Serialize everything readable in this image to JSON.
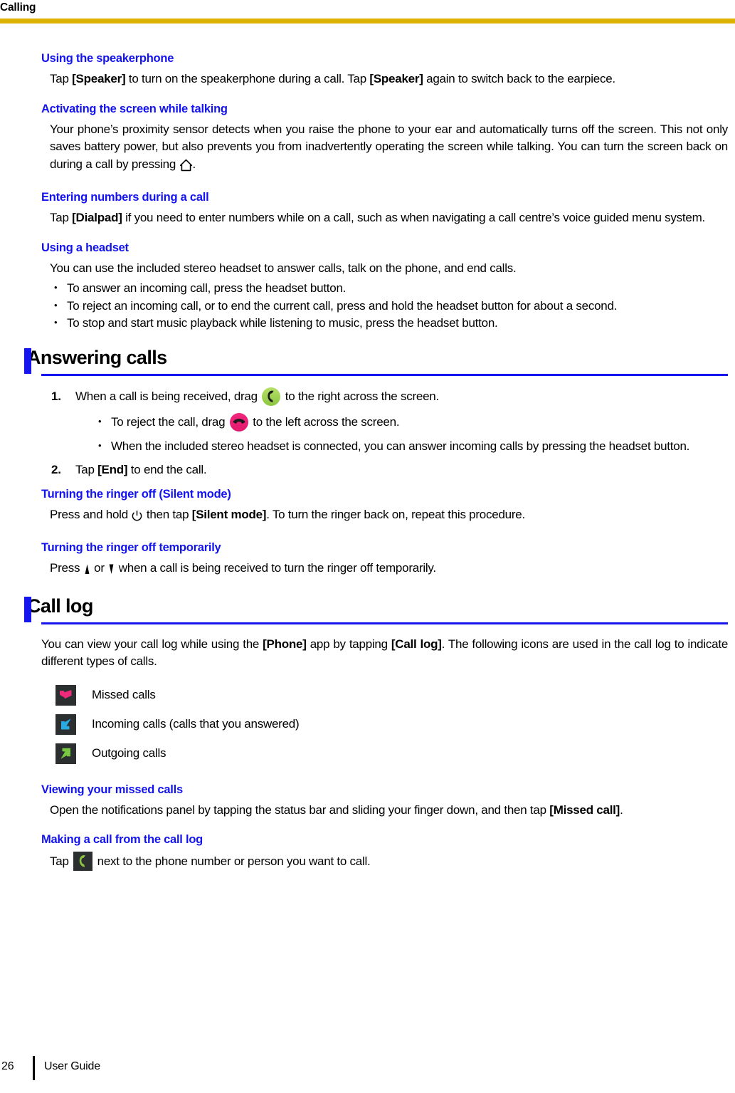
{
  "header": {
    "running_title": "Calling",
    "rule_color": "#ddb200"
  },
  "colors": {
    "subheading": "#1313ef",
    "section_accent": "#1515ee",
    "header_rule": "#ddb200",
    "answer_green": "#8cc63f",
    "reject_pink": "#e21a6e",
    "missed_pink": "#ee2a7b",
    "incoming_blue": "#29abe2",
    "outgoing_green": "#7ac943",
    "icon_tile_dark": "#2b2f30"
  },
  "sections": [
    {
      "id": "using-the-speakerphone",
      "heading": "Using the speakerphone",
      "body_pre": "Tap ",
      "bold1": "[Speaker]",
      "body_mid": " to turn on the speakerphone during a call. Tap ",
      "bold2": "[Speaker]",
      "body_post": " again to switch back to the earpiece."
    },
    {
      "id": "activating-the-screen-while-talking",
      "heading": "Activating the screen while talking",
      "body_pre": "Your phone’s proximity sensor detects when you raise the phone to your ear and automatically turns off the screen. This not only saves battery power, but also prevents you from inadvertently operating the screen while talking. You can turn the screen back on during a call by pressing ",
      "icon": "home-icon",
      "body_post": "."
    },
    {
      "id": "entering-numbers-during-a-call",
      "heading": "Entering numbers during a call",
      "body_pre": "Tap ",
      "bold1": "[Dialpad]",
      "body_post": " if you need to enter numbers while on a call, such as when navigating a call centre’s voice guided menu system."
    },
    {
      "id": "using-a-headset",
      "heading": "Using a headset",
      "intro": "You can use the included stereo headset to answer calls, talk on the phone, and end calls.",
      "bullets": [
        "To answer an incoming call, press the headset button.",
        "To reject an incoming call, or to end the current call, press and hold the headset button for about a second.",
        "To stop and start music playback while listening to music, press the headset button."
      ]
    }
  ],
  "answering_calls": {
    "title": "Answering calls",
    "step1": {
      "number": "1.",
      "text_pre": "When a call is being received, drag ",
      "icon": "answer-call-icon",
      "text_post": " to the right across the screen."
    },
    "substeps": [
      {
        "text_pre": "To reject the call, drag ",
        "icon": "reject-call-icon",
        "text_post": " to the left across the screen."
      },
      {
        "text_pre": "When the included stereo headset is connected, you can answer incoming calls by pressing the headset button.",
        "icon": null,
        "text_post": ""
      }
    ],
    "step2": {
      "number": "2.",
      "text_pre": "Tap ",
      "bold": "[End]",
      "text_post": " to end the call."
    },
    "silent_mode": {
      "heading": "Turning the ringer off (Silent mode)",
      "text_pre": "Press and hold ",
      "icon": "power-icon",
      "text_mid": " then tap ",
      "bold": "[Silent mode]",
      "text_post": ". To turn the ringer back on, repeat this procedure."
    },
    "ringer_temp": {
      "heading": "Turning the ringer off temporarily",
      "text_pre": "Press ",
      "icon_up": "volume-up-icon",
      "text_mid": " or ",
      "icon_down": "volume-down-icon",
      "text_post": " when a call is being received to turn the ringer off temporarily."
    }
  },
  "call_log": {
    "title": "Call log",
    "intro_pre": "You can view your call log while using the ",
    "intro_bold1": "[Phone]",
    "intro_mid": " app by tapping ",
    "intro_bold2": "[Call log]",
    "intro_post": ". The following icons are used in the call log to indicate different types of calls.",
    "legend": [
      {
        "icon": "missed-call-icon",
        "label": "Missed calls"
      },
      {
        "icon": "incoming-call-icon",
        "label": "Incoming calls (calls that you answered)"
      },
      {
        "icon": "outgoing-call-icon",
        "label": "Outgoing calls"
      }
    ],
    "missed_calls": {
      "heading": "Viewing your missed calls",
      "text_pre": "Open the notifications panel by tapping the status bar and sliding your finger down, and then tap ",
      "bold": "[Missed call]",
      "text_post": "."
    },
    "making_call": {
      "heading": "Making a call from the call log",
      "text_pre": "Tap ",
      "icon": "dial-call-icon",
      "text_post": " next to the phone number or person you want to call."
    }
  },
  "footer": {
    "page_number": "26",
    "label": "User Guide"
  }
}
